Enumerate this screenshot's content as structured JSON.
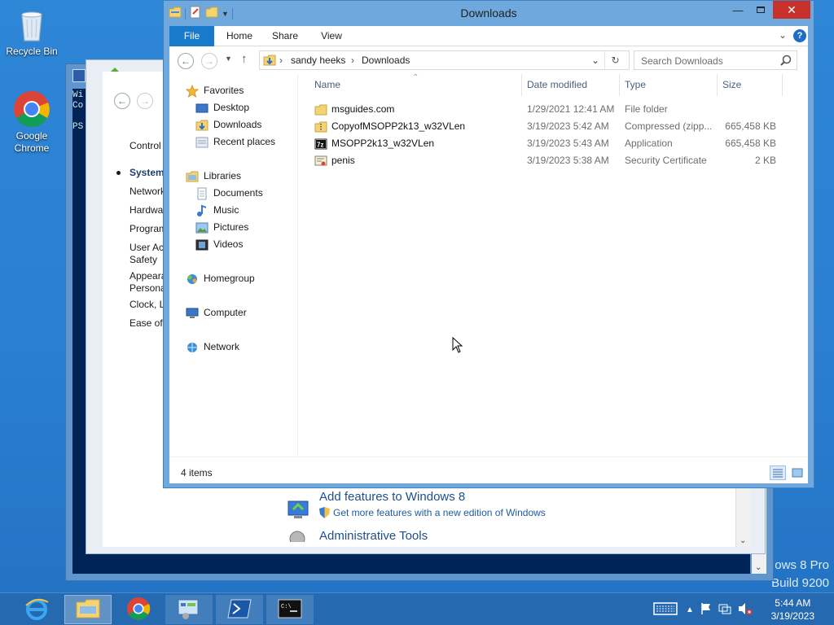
{
  "desktop": {
    "icons": [
      {
        "label": "Recycle Bin",
        "icon": "recycle-bin-icon"
      },
      {
        "label": "Google Chrome",
        "icon": "chrome-icon"
      }
    ],
    "watermark": {
      "line1": "ows 8 Pro",
      "line2": "Build 9200"
    }
  },
  "powershell": {
    "lines": [
      "Wi",
      "Co",
      "",
      "PS"
    ]
  },
  "control_panel": {
    "links": [
      "Control",
      "System",
      "Network",
      "Hardwa",
      "Program",
      "User Ac",
      "Safety",
      "Appeara",
      "Persona",
      "Clock, L",
      "Ease of"
    ],
    "add_features_title": "Add features to Windows 8",
    "add_features_link": "Get more features with a new edition of Windows",
    "admin_tools_title": "Administrative Tools"
  },
  "explorer": {
    "title": "Downloads",
    "ribbon_tabs": [
      "File",
      "Home",
      "Share",
      "View"
    ],
    "breadcrumb": [
      "sandy heeks",
      "Downloads"
    ],
    "search_placeholder": "Search Downloads",
    "nav": {
      "favorites": "Favorites",
      "favorites_items": [
        "Desktop",
        "Downloads",
        "Recent places"
      ],
      "libraries": "Libraries",
      "libraries_items": [
        "Documents",
        "Music",
        "Pictures",
        "Videos"
      ],
      "homegroup": "Homegroup",
      "computer": "Computer",
      "network": "Network"
    },
    "columns": [
      "Name",
      "Date modified",
      "Type",
      "Size"
    ],
    "files": [
      {
        "name": "msguides.com",
        "date": "1/29/2021 12:41 AM",
        "type": "File folder",
        "size": "",
        "icon": "folder-icon"
      },
      {
        "name": "CopyofMSOPP2k13_w32VLen",
        "date": "3/19/2023 5:42 AM",
        "type": "Compressed (zipp...",
        "size": "665,458 KB",
        "icon": "zip-folder-icon"
      },
      {
        "name": "MSOPP2k13_w32VLen",
        "date": "3/19/2023 5:43 AM",
        "type": "Application",
        "size": "665,458 KB",
        "icon": "7zip-app-icon"
      },
      {
        "name": "penis",
        "date": "3/19/2023 5:38 AM",
        "type": "Security Certificate",
        "size": "2 KB",
        "icon": "certificate-icon"
      }
    ],
    "status": "4 items"
  },
  "taskbar": {
    "apps": [
      "internet-explorer-icon",
      "file-explorer-icon",
      "chrome-icon",
      "control-panel-icon",
      "powershell-icon",
      "command-prompt-icon"
    ],
    "time": "5:44 AM",
    "date": "3/19/2023"
  },
  "colors": {
    "accent": "#1979ca",
    "window_frame": "#6fa8dc",
    "close": "#c7302b",
    "desktop": "#2a7fd0"
  }
}
